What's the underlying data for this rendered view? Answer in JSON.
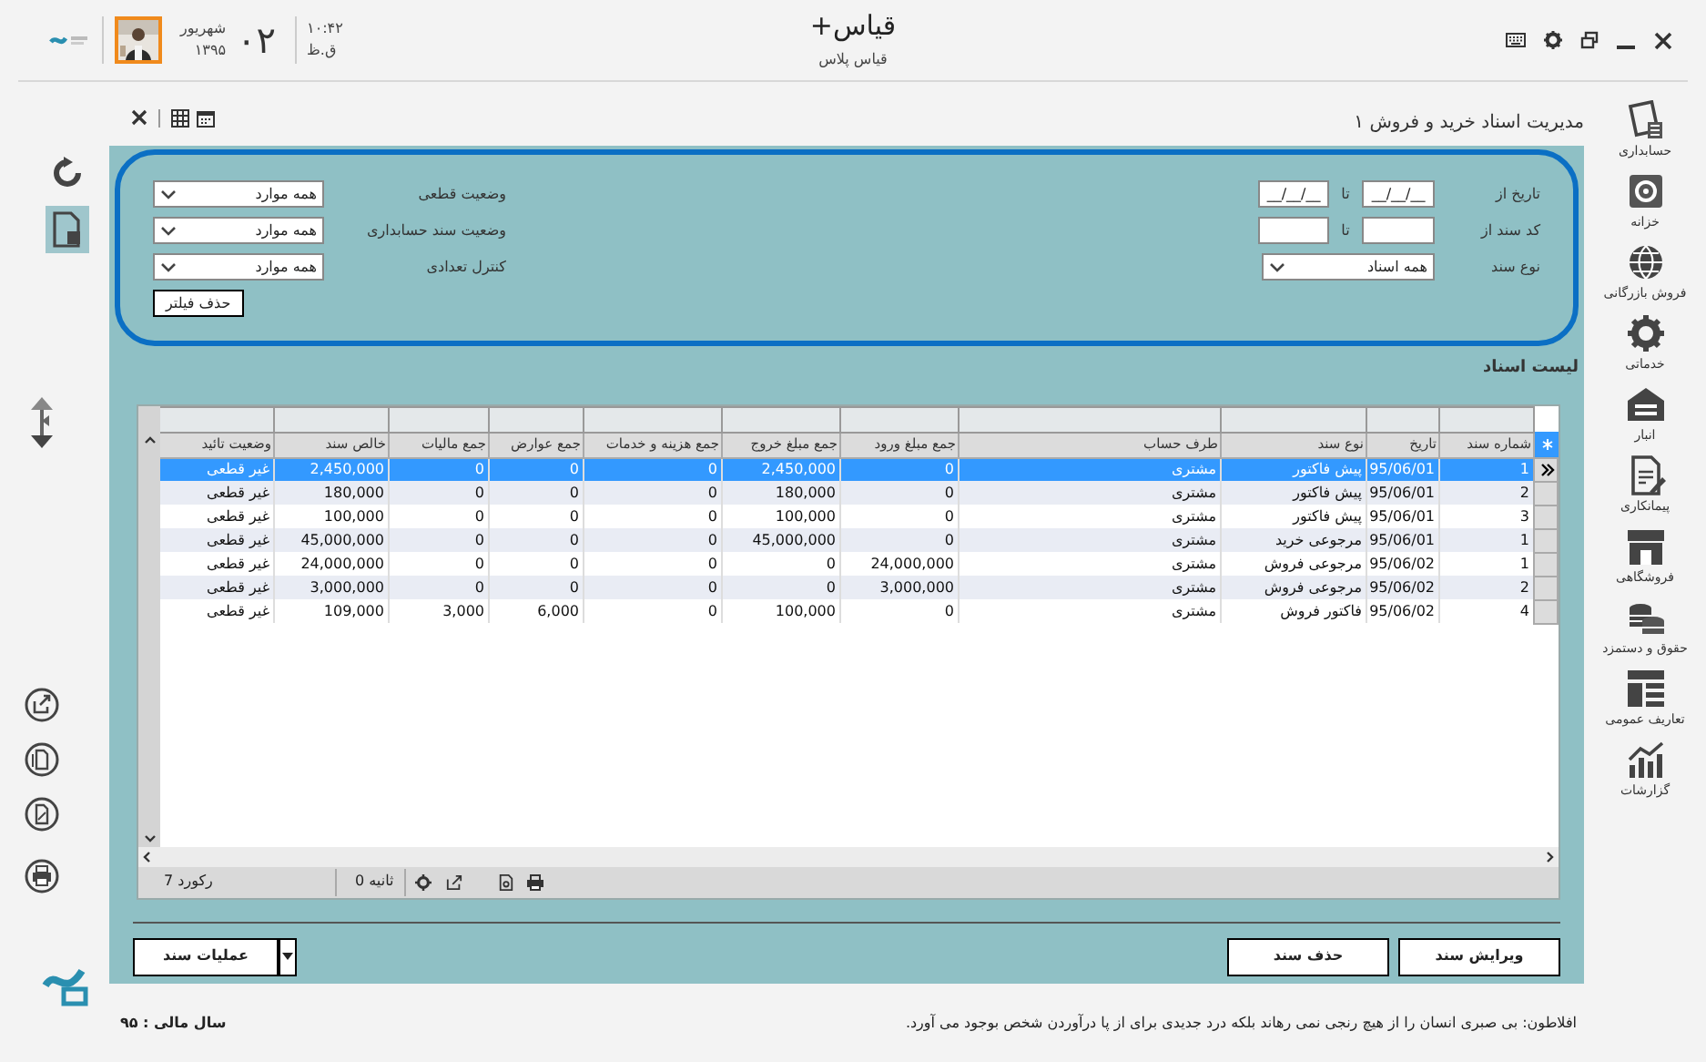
{
  "window": {
    "title": "قیاس+",
    "subtitle": "قیاس پلاس"
  },
  "clock": {
    "day": "۰۲",
    "month": "شهریور",
    "year": "۱۳۹۵",
    "time": "۱۰:۴۲",
    "meridiem": "ق.ظ"
  },
  "page_title": "مدیریت اسناد خرید و فروش ۱",
  "nav": [
    {
      "label": "حسابداری"
    },
    {
      "label": "خزانه"
    },
    {
      "label": "فروش بازرگانی"
    },
    {
      "label": "خدماتی"
    },
    {
      "label": "انبار"
    },
    {
      "label": "پیمانکاری"
    },
    {
      "label": "فروشگاهی"
    },
    {
      "label": "حقوق و دستمزد"
    },
    {
      "label": "تعاریف عمومی"
    },
    {
      "label": "گزارشات"
    }
  ],
  "filters": {
    "right": [
      {
        "label": "تاریخ از",
        "kind": "range",
        "from": "__/__/__",
        "to_label": "تا",
        "to": "__/__/__"
      },
      {
        "label": "کد سند از",
        "kind": "range",
        "to_label": "تا"
      },
      {
        "label": "نوع سند",
        "kind": "select",
        "value": "همه اسناد"
      }
    ],
    "left": [
      {
        "label": "وضعیت قطعی",
        "value": "همه موارد"
      },
      {
        "label": "وضعیت سند حسابداری",
        "value": "همه موارد"
      },
      {
        "label": "کنترل تعدادی",
        "value": "همه موارد"
      }
    ],
    "clear_button": "حذف فیلتر"
  },
  "list_title": "لیست اسناد",
  "table": {
    "columns": [
      "شماره سند",
      "تاریخ",
      "نوع سند",
      "طرف حساب",
      "جمع مبلغ ورود",
      "جمع مبلغ خروج",
      "جمع هزینه و خدمات",
      "جمع عوارض",
      "جمع مالیات",
      "خالص سند",
      "وضعیت تائید"
    ],
    "rows": [
      {
        "selected": true,
        "cells": [
          "1",
          "95/06/01",
          "پیش فاکتور",
          "مشتری",
          "0",
          "2,450,000",
          "0",
          "0",
          "0",
          "2,450,000",
          "غیر قطعی"
        ]
      },
      {
        "selected": false,
        "cells": [
          "2",
          "95/06/01",
          "پیش فاکتور",
          "مشتری",
          "0",
          "180,000",
          "0",
          "0",
          "0",
          "180,000",
          "غیر قطعی"
        ]
      },
      {
        "selected": false,
        "cells": [
          "3",
          "95/06/01",
          "پیش فاکتور",
          "مشتری",
          "0",
          "100,000",
          "0",
          "0",
          "0",
          "100,000",
          "غیر قطعی"
        ]
      },
      {
        "selected": false,
        "cells": [
          "1",
          "95/06/01",
          "مرجوعی خرید",
          "مشتری",
          "0",
          "45,000,000",
          "0",
          "0",
          "0",
          "45,000,000",
          "غیر قطعی"
        ]
      },
      {
        "selected": false,
        "cells": [
          "1",
          "95/06/02",
          "مرجوعی فروش",
          "مشتری",
          "24,000,000",
          "0",
          "0",
          "0",
          "0",
          "24,000,000",
          "غیر قطعی"
        ]
      },
      {
        "selected": false,
        "cells": [
          "2",
          "95/06/02",
          "مرجوعی فروش",
          "مشتری",
          "3,000,000",
          "0",
          "0",
          "0",
          "0",
          "3,000,000",
          "غیر قطعی"
        ]
      },
      {
        "selected": false,
        "cells": [
          "4",
          "95/06/02",
          "فاکتور فروش",
          "مشتری",
          "0",
          "100,000",
          "0",
          "6,000",
          "3,000",
          "109,000",
          "غیر قطعی"
        ]
      }
    ]
  },
  "grid_footer": {
    "records": "7 رکورد",
    "elapsed": "0 ثانیه"
  },
  "buttons": {
    "edit": "ویرایش سند",
    "delete": "حذف سند",
    "operations": "عملیات سند"
  },
  "status_bar": {
    "quote": "افلاطون: بی صبری انسان را از هیچ رنجی نمی رهاند بلکه درد جدیدی برای از پا درآوردن شخص بوجود می آورد.",
    "fiscal_year": "سال مالی : ۹۵"
  }
}
